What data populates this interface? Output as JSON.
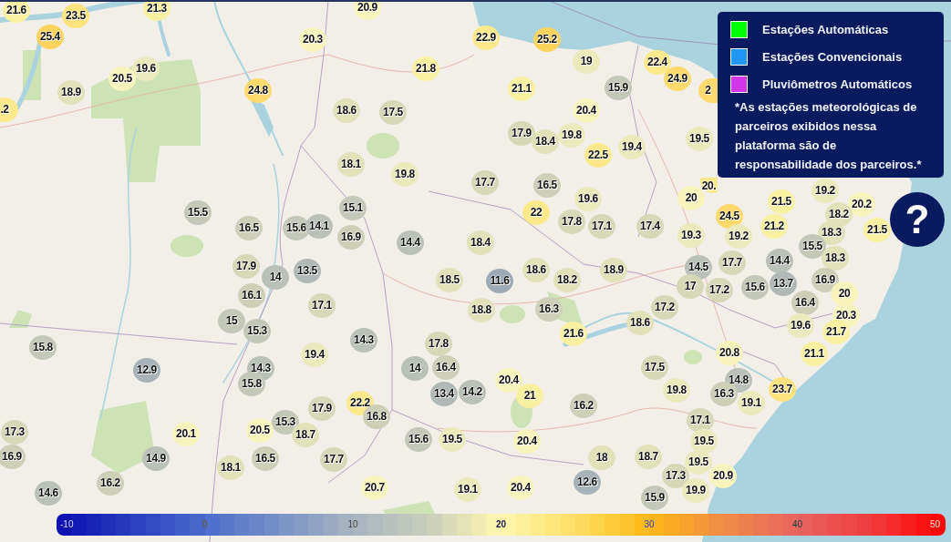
{
  "markers": [
    {
      "value": "21.6",
      "color": "#faf0a1"
    },
    {
      "value": "23.5",
      "color": "#fde37d"
    },
    {
      "value": "21.3",
      "color": "#faf0a1"
    },
    {
      "value": "20.9",
      "color": "#f7f3bc"
    },
    {
      "value": "25.4",
      "color": "#fdd35d"
    },
    {
      "value": "20.3",
      "color": "#f7f3bc"
    },
    {
      "value": "22.9",
      "color": "#fce98b"
    },
    {
      "value": "25.2",
      "color": "#fdd35d"
    },
    {
      "value": "19.6",
      "color": "#ebeabd"
    },
    {
      "value": "21.8",
      "color": "#faf0a1"
    },
    {
      "value": "19",
      "color": "#ebeabd"
    },
    {
      "value": "22.4",
      "color": "#fce98b"
    },
    {
      "value": "20.5",
      "color": "#f7f3bc"
    },
    {
      "value": "24.9",
      "color": "#fdda6b"
    },
    {
      "value": "18.9",
      "color": "#e1e1ba"
    },
    {
      "value": "24.8",
      "color": "#fdda6b"
    },
    {
      "value": "21.1",
      "color": "#faf0a1"
    },
    {
      "value": "15.9",
      "color": "#c3c8b7"
    },
    {
      "value": "2",
      "color": "#fdda6b"
    },
    {
      "value": ".2",
      "color": "#fce98b"
    },
    {
      "value": "18.6",
      "color": "#e1e1ba"
    },
    {
      "value": "17.5",
      "color": "#d7d8b8"
    },
    {
      "value": "20.4",
      "color": "#f7f3bc"
    },
    {
      "value": "17.9",
      "color": "#d7d8b8"
    },
    {
      "value": "18.4",
      "color": "#e1e1ba"
    },
    {
      "value": "19.8",
      "color": "#ebeabd"
    },
    {
      "value": "19.4",
      "color": "#ebeabd"
    },
    {
      "value": "19.5",
      "color": "#ebeabd"
    },
    {
      "value": "22.5",
      "color": "#fce98b"
    },
    {
      "value": "18.1",
      "color": "#e1e1ba"
    },
    {
      "value": "19.8",
      "color": "#ebeabd"
    },
    {
      "value": "17.7",
      "color": "#d7d8b8"
    },
    {
      "value": "16.5",
      "color": "#cdcfb7"
    },
    {
      "value": "20.",
      "color": "#fce98b"
    },
    {
      "value": "19.2",
      "color": "#ebeabd"
    },
    {
      "value": "19.6",
      "color": "#ebeabd"
    },
    {
      "value": "20",
      "color": "#f7f3bc"
    },
    {
      "value": "21.5",
      "color": "#faf0a1"
    },
    {
      "value": "20.2",
      "color": "#f7f3bc"
    },
    {
      "value": "15.5",
      "color": "#c3c8b7"
    },
    {
      "value": "15.1",
      "color": "#c3c8b7"
    },
    {
      "value": "22",
      "color": "#fce98b"
    },
    {
      "value": "24.5",
      "color": "#fdda6b"
    },
    {
      "value": "18.2",
      "color": "#e1e1ba"
    },
    {
      "value": "16.5",
      "color": "#cdcfb7"
    },
    {
      "value": "15.6",
      "color": "#c3c8b7"
    },
    {
      "value": "14.1",
      "color": "#b9c1b8"
    },
    {
      "value": "17.8",
      "color": "#d7d8b8"
    },
    {
      "value": "17.1",
      "color": "#d7d8b8"
    },
    {
      "value": "17.4",
      "color": "#d7d8b8"
    },
    {
      "value": "21.2",
      "color": "#faf0a1"
    },
    {
      "value": "21.5",
      "color": "#faf0a1"
    },
    {
      "value": "16.9",
      "color": "#cdcfb7"
    },
    {
      "value": "19.3",
      "color": "#ebeabd"
    },
    {
      "value": "19.2",
      "color": "#ebeabd"
    },
    {
      "value": "18.3",
      "color": "#e1e1ba"
    },
    {
      "value": "14.4",
      "color": "#b9c1b8"
    },
    {
      "value": "18.4",
      "color": "#e1e1ba"
    },
    {
      "value": "15.5",
      "color": "#c3c8b7"
    },
    {
      "value": "17.7",
      "color": "#d7d8b8"
    },
    {
      "value": "14.4",
      "color": "#b9c1b8"
    },
    {
      "value": "18.3",
      "color": "#e1e1ba"
    },
    {
      "value": "17.9",
      "color": "#d7d8b8"
    },
    {
      "value": "13.5",
      "color": "#b0b9b8"
    },
    {
      "value": "18.6",
      "color": "#e1e1ba"
    },
    {
      "value": "18.9",
      "color": "#e1e1ba"
    },
    {
      "value": "14.5",
      "color": "#b9c1b8"
    },
    {
      "value": "14",
      "color": "#b9c1b8"
    },
    {
      "value": "18.5",
      "color": "#e1e1ba"
    },
    {
      "value": "11.6",
      "color": "#9dabb8"
    },
    {
      "value": "18.2",
      "color": "#e1e1ba"
    },
    {
      "value": "16.9",
      "color": "#cdcfb7"
    },
    {
      "value": "17",
      "color": "#d7d8b8"
    },
    {
      "value": "17.2",
      "color": "#d7d8b8"
    },
    {
      "value": "15.6",
      "color": "#c3c8b7"
    },
    {
      "value": "13.7",
      "color": "#b0b9b8"
    },
    {
      "value": "16.1",
      "color": "#cdcfb7"
    },
    {
      "value": "20",
      "color": "#f7f3bc"
    },
    {
      "value": "17.1",
      "color": "#d7d8b8"
    },
    {
      "value": "18.8",
      "color": "#e1e1ba"
    },
    {
      "value": "16.3",
      "color": "#cdcfb7"
    },
    {
      "value": "17.2",
      "color": "#d7d8b8"
    },
    {
      "value": "16.4",
      "color": "#cdcfb7"
    },
    {
      "value": "15",
      "color": "#c3c8b7"
    },
    {
      "value": "18.6",
      "color": "#e1e1ba"
    },
    {
      "value": "19.6",
      "color": "#ebeabd"
    },
    {
      "value": "20.3",
      "color": "#f7f3bc"
    },
    {
      "value": "15.3",
      "color": "#c3c8b7"
    },
    {
      "value": "21.6",
      "color": "#faf0a1"
    },
    {
      "value": "21.7",
      "color": "#faf0a1"
    },
    {
      "value": "15.8",
      "color": "#c3c8b7"
    },
    {
      "value": "14.3",
      "color": "#b9c1b8"
    },
    {
      "value": "17.8",
      "color": "#d7d8b8"
    },
    {
      "value": "19.4",
      "color": "#ebeabd"
    },
    {
      "value": "20.8",
      "color": "#f7f3bc"
    },
    {
      "value": "21.1",
      "color": "#faf0a1"
    },
    {
      "value": "12.9",
      "color": "#a7b2b9"
    },
    {
      "value": "14.3",
      "color": "#b9c1b8"
    },
    {
      "value": "14",
      "color": "#b9c1b8"
    },
    {
      "value": "16.4",
      "color": "#cdcfb7"
    },
    {
      "value": "17.5",
      "color": "#d7d8b8"
    },
    {
      "value": "15.8",
      "color": "#c3c8b7"
    },
    {
      "value": "20.4",
      "color": "#f7f3bc"
    },
    {
      "value": "14.8",
      "color": "#b9c1b8"
    },
    {
      "value": "13.4",
      "color": "#b0b9b8"
    },
    {
      "value": "14.2",
      "color": "#b9c1b8"
    },
    {
      "value": "21",
      "color": "#faf0a1"
    },
    {
      "value": "19.8",
      "color": "#ebeabd"
    },
    {
      "value": "16.3",
      "color": "#cdcfb7"
    },
    {
      "value": "23.7",
      "color": "#fde37d"
    },
    {
      "value": "17.9",
      "color": "#d7d8b8"
    },
    {
      "value": "22.2",
      "color": "#fce98b"
    },
    {
      "value": "16.2",
      "color": "#cdcfb7"
    },
    {
      "value": "19.1",
      "color": "#ebeabd"
    },
    {
      "value": "15.3",
      "color": "#c3c8b7"
    },
    {
      "value": "16.8",
      "color": "#cdcfb7"
    },
    {
      "value": "17.1",
      "color": "#d7d8b8"
    },
    {
      "value": "17.3",
      "color": "#d7d8b8"
    },
    {
      "value": "20.1",
      "color": "#f7f3bc"
    },
    {
      "value": "20.5",
      "color": "#f7f3bc"
    },
    {
      "value": "18.7",
      "color": "#e1e1ba"
    },
    {
      "value": "15.6",
      "color": "#c3c8b7"
    },
    {
      "value": "19.5",
      "color": "#ebeabd"
    },
    {
      "value": "20.4",
      "color": "#f7f3bc"
    },
    {
      "value": "19.5",
      "color": "#ebeabd"
    },
    {
      "value": "16.9",
      "color": "#cdcfb7"
    },
    {
      "value": "14.9",
      "color": "#b9c1b8"
    },
    {
      "value": "16.5",
      "color": "#cdcfb7"
    },
    {
      "value": "17.7",
      "color": "#d7d8b8"
    },
    {
      "value": "18",
      "color": "#e1e1ba"
    },
    {
      "value": "18.7",
      "color": "#e1e1ba"
    },
    {
      "value": "19.5",
      "color": "#ebeabd"
    },
    {
      "value": "18.1",
      "color": "#e1e1ba"
    },
    {
      "value": "16.2",
      "color": "#cdcfb7"
    },
    {
      "value": "12.6",
      "color": "#a7b2b9"
    },
    {
      "value": "17.3",
      "color": "#d7d8b8"
    },
    {
      "value": "20.9",
      "color": "#f7f3bc"
    },
    {
      "value": "14.6",
      "color": "#b9c1b8"
    },
    {
      "value": "20.7",
      "color": "#f7f3bc"
    },
    {
      "value": "19.1",
      "color": "#ebeabd"
    },
    {
      "value": "20.4",
      "color": "#f7f3bc"
    },
    {
      "value": "15.9",
      "color": "#c3c8b7"
    },
    {
      "value": "19.9",
      "color": "#ebeabd"
    }
  ],
  "legend": {
    "items": [
      {
        "label": "Estações Automáticas",
        "color": "#00ff00"
      },
      {
        "label": "Estações Convencionais",
        "color": "#2196f3"
      },
      {
        "label": "Pluviômetros Automáticos",
        "color": "#d336e8"
      }
    ],
    "note": "*As estações meteorológicas de parceiros exibidos nessa plataforma são de responsabilidade dos parceiros.*"
  },
  "help_button": {
    "label": "?"
  },
  "color_scale": {
    "labels": [
      "-10",
      "0",
      "10",
      "20",
      "30",
      "40",
      "50"
    ]
  }
}
